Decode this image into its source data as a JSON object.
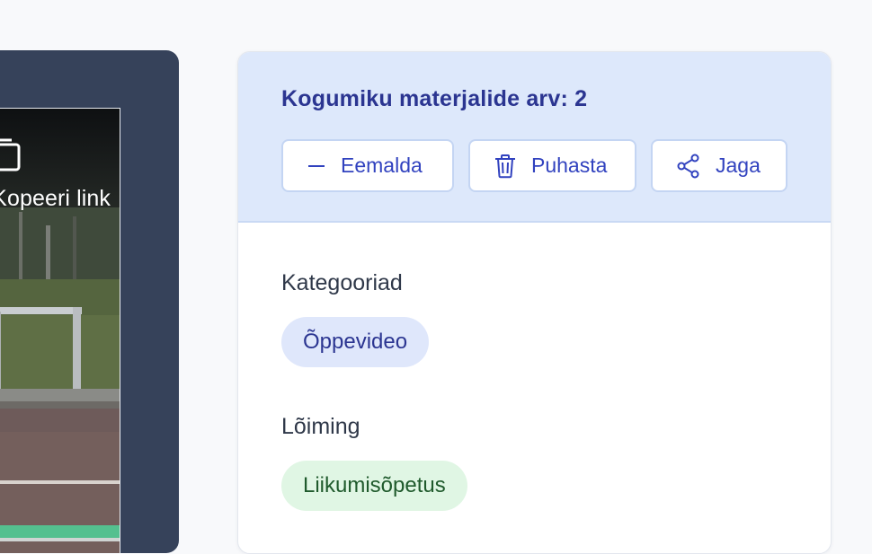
{
  "media": {
    "copy_link_label": "Kopeeri link",
    "copy_icon": "copy-icon"
  },
  "panel": {
    "header": {
      "collection_count": "Kogumiku materjalide arv: 2"
    },
    "actions": {
      "remove_label": "Eemalda",
      "remove_icon": "minus-icon",
      "clear_label": "Puhasta",
      "clear_icon": "trash-icon",
      "share_label": "Jaga",
      "share_icon": "share-icon"
    },
    "categories": {
      "label": "Kategooriad",
      "items": [
        "Õppevideo"
      ]
    },
    "integration": {
      "label": "Lõiming",
      "items": [
        "Liikumisõpetus"
      ]
    }
  },
  "colors": {
    "page_background": "#f8f9fb",
    "media_card": "#36425a",
    "header_background": "#dde8fb",
    "accent_blue": "#3142bf",
    "heading_blue": "#2b3591",
    "chip_blue_bg": "#dfe7fb",
    "chip_green_bg": "#e0f6e4",
    "chip_green_text": "#1f5a2c"
  }
}
